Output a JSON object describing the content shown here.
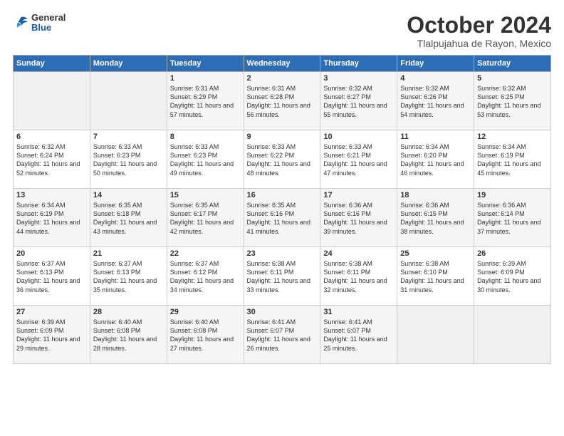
{
  "logo": {
    "general": "General",
    "blue": "Blue"
  },
  "header": {
    "month": "October 2024",
    "location": "Tlalpujahua de Rayon, Mexico"
  },
  "weekdays": [
    "Sunday",
    "Monday",
    "Tuesday",
    "Wednesday",
    "Thursday",
    "Friday",
    "Saturday"
  ],
  "weeks": [
    [
      {
        "day": "",
        "empty": true
      },
      {
        "day": "",
        "empty": true
      },
      {
        "day": "1",
        "sunrise": "6:31 AM",
        "sunset": "6:29 PM",
        "daylight": "11 hours and 57 minutes."
      },
      {
        "day": "2",
        "sunrise": "6:31 AM",
        "sunset": "6:28 PM",
        "daylight": "11 hours and 56 minutes."
      },
      {
        "day": "3",
        "sunrise": "6:32 AM",
        "sunset": "6:27 PM",
        "daylight": "11 hours and 55 minutes."
      },
      {
        "day": "4",
        "sunrise": "6:32 AM",
        "sunset": "6:26 PM",
        "daylight": "11 hours and 54 minutes."
      },
      {
        "day": "5",
        "sunrise": "6:32 AM",
        "sunset": "6:25 PM",
        "daylight": "11 hours and 53 minutes."
      }
    ],
    [
      {
        "day": "6",
        "sunrise": "6:32 AM",
        "sunset": "6:24 PM",
        "daylight": "11 hours and 52 minutes."
      },
      {
        "day": "7",
        "sunrise": "6:33 AM",
        "sunset": "6:23 PM",
        "daylight": "11 hours and 50 minutes."
      },
      {
        "day": "8",
        "sunrise": "6:33 AM",
        "sunset": "6:23 PM",
        "daylight": "11 hours and 49 minutes."
      },
      {
        "day": "9",
        "sunrise": "6:33 AM",
        "sunset": "6:22 PM",
        "daylight": "11 hours and 48 minutes."
      },
      {
        "day": "10",
        "sunrise": "6:33 AM",
        "sunset": "6:21 PM",
        "daylight": "11 hours and 47 minutes."
      },
      {
        "day": "11",
        "sunrise": "6:34 AM",
        "sunset": "6:20 PM",
        "daylight": "11 hours and 46 minutes."
      },
      {
        "day": "12",
        "sunrise": "6:34 AM",
        "sunset": "6:19 PM",
        "daylight": "11 hours and 45 minutes."
      }
    ],
    [
      {
        "day": "13",
        "sunrise": "6:34 AM",
        "sunset": "6:19 PM",
        "daylight": "11 hours and 44 minutes."
      },
      {
        "day": "14",
        "sunrise": "6:35 AM",
        "sunset": "6:18 PM",
        "daylight": "11 hours and 43 minutes."
      },
      {
        "day": "15",
        "sunrise": "6:35 AM",
        "sunset": "6:17 PM",
        "daylight": "11 hours and 42 minutes."
      },
      {
        "day": "16",
        "sunrise": "6:35 AM",
        "sunset": "6:16 PM",
        "daylight": "11 hours and 41 minutes."
      },
      {
        "day": "17",
        "sunrise": "6:36 AM",
        "sunset": "6:16 PM",
        "daylight": "11 hours and 39 minutes."
      },
      {
        "day": "18",
        "sunrise": "6:36 AM",
        "sunset": "6:15 PM",
        "daylight": "11 hours and 38 minutes."
      },
      {
        "day": "19",
        "sunrise": "6:36 AM",
        "sunset": "6:14 PM",
        "daylight": "11 hours and 37 minutes."
      }
    ],
    [
      {
        "day": "20",
        "sunrise": "6:37 AM",
        "sunset": "6:13 PM",
        "daylight": "11 hours and 36 minutes."
      },
      {
        "day": "21",
        "sunrise": "6:37 AM",
        "sunset": "6:13 PM",
        "daylight": "11 hours and 35 minutes."
      },
      {
        "day": "22",
        "sunrise": "6:37 AM",
        "sunset": "6:12 PM",
        "daylight": "11 hours and 34 minutes."
      },
      {
        "day": "23",
        "sunrise": "6:38 AM",
        "sunset": "6:11 PM",
        "daylight": "11 hours and 33 minutes."
      },
      {
        "day": "24",
        "sunrise": "6:38 AM",
        "sunset": "6:11 PM",
        "daylight": "11 hours and 32 minutes."
      },
      {
        "day": "25",
        "sunrise": "6:38 AM",
        "sunset": "6:10 PM",
        "daylight": "11 hours and 31 minutes."
      },
      {
        "day": "26",
        "sunrise": "6:39 AM",
        "sunset": "6:09 PM",
        "daylight": "11 hours and 30 minutes."
      }
    ],
    [
      {
        "day": "27",
        "sunrise": "6:39 AM",
        "sunset": "6:09 PM",
        "daylight": "11 hours and 29 minutes."
      },
      {
        "day": "28",
        "sunrise": "6:40 AM",
        "sunset": "6:08 PM",
        "daylight": "11 hours and 28 minutes."
      },
      {
        "day": "29",
        "sunrise": "6:40 AM",
        "sunset": "6:08 PM",
        "daylight": "11 hours and 27 minutes."
      },
      {
        "day": "30",
        "sunrise": "6:41 AM",
        "sunset": "6:07 PM",
        "daylight": "11 hours and 26 minutes."
      },
      {
        "day": "31",
        "sunrise": "6:41 AM",
        "sunset": "6:07 PM",
        "daylight": "11 hours and 25 minutes."
      },
      {
        "day": "",
        "empty": true
      },
      {
        "day": "",
        "empty": true
      }
    ]
  ],
  "labels": {
    "sunrise": "Sunrise:",
    "sunset": "Sunset:",
    "daylight": "Daylight:"
  }
}
